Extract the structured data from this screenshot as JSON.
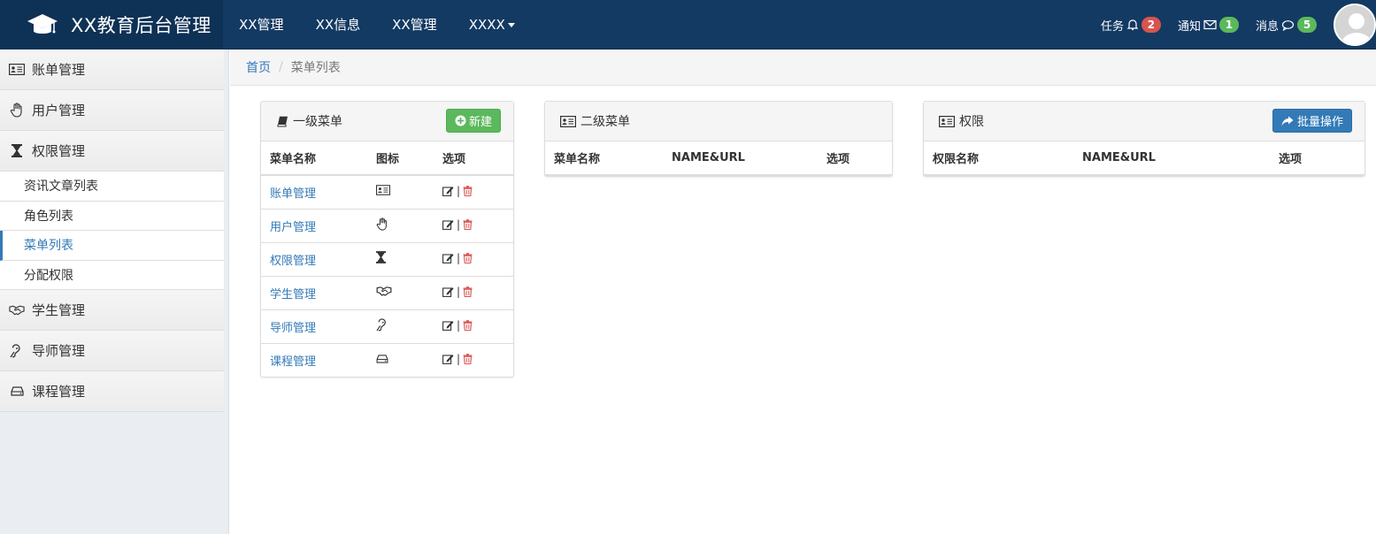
{
  "header": {
    "brand_title": "XX教育后台管理",
    "nav": [
      {
        "label": "XX管理"
      },
      {
        "label": "XX信息"
      },
      {
        "label": "XX管理"
      },
      {
        "label": "XXXX"
      }
    ],
    "tasks": {
      "label": "任务",
      "count": "2"
    },
    "notices": {
      "label": "通知",
      "count": "1"
    },
    "messages": {
      "label": "消息",
      "count": "5"
    }
  },
  "sidebar": {
    "items": [
      {
        "label": "账单管理",
        "icon": "id-card-icon"
      },
      {
        "label": "用户管理",
        "icon": "hand-icon"
      },
      {
        "label": "权限管理",
        "icon": "hourglass-icon"
      }
    ],
    "sub_items": [
      {
        "label": "资讯文章列表"
      },
      {
        "label": "角色列表"
      },
      {
        "label": "菜单列表"
      },
      {
        "label": "分配权限"
      }
    ],
    "items2": [
      {
        "label": "学生管理",
        "icon": "handshake-icon"
      },
      {
        "label": "导师管理",
        "icon": "ear-icon"
      },
      {
        "label": "课程管理",
        "icon": "drive-icon"
      }
    ]
  },
  "breadcrumb": {
    "home": "首页",
    "separator": "/",
    "current": "菜单列表"
  },
  "panel1": {
    "title": "一级菜单",
    "new_button": "新建",
    "columns": [
      "菜单名称",
      "图标",
      "选项"
    ],
    "rows": [
      {
        "name": "账单管理",
        "icon": "id-card-icon"
      },
      {
        "name": "用户管理",
        "icon": "hand-icon"
      },
      {
        "name": "权限管理",
        "icon": "hourglass-icon"
      },
      {
        "name": "学生管理",
        "icon": "handshake-icon"
      },
      {
        "name": "导师管理",
        "icon": "ear-icon"
      },
      {
        "name": "课程管理",
        "icon": "drive-icon"
      }
    ],
    "op_separator": "|"
  },
  "panel2": {
    "title": "二级菜单",
    "columns": [
      "菜单名称",
      "NAME&URL",
      "选项"
    ]
  },
  "panel3": {
    "title": "权限",
    "batch_button": "批量操作",
    "columns": [
      "权限名称",
      "NAME&URL",
      "选项"
    ]
  },
  "colors": {
    "topbar": "#133a63",
    "brand": "#0e3156",
    "link": "#337ab7",
    "success": "#5cb85c",
    "danger": "#d9534f"
  }
}
